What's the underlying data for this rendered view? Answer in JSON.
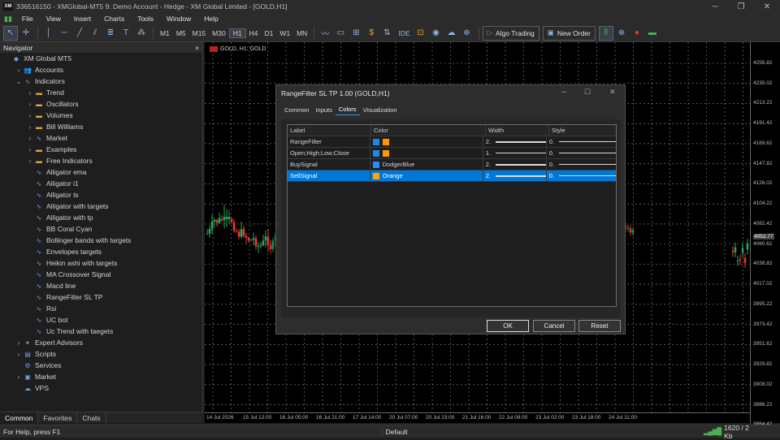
{
  "window": {
    "title": "336516150 - XMGlobal-MT5 9: Demo Account - Hedge - XM Global Limited - [GOLD,H1]",
    "logo": "XM"
  },
  "menu": [
    "File",
    "View",
    "Insert",
    "Charts",
    "Tools",
    "Window",
    "Help"
  ],
  "toolbar": {
    "timeframes": [
      "M1",
      "M5",
      "M15",
      "M30",
      "H1",
      "H4",
      "D1",
      "W1",
      "MN"
    ],
    "active_tf": "H1",
    "ide": "IDE",
    "algo": "Algo Trading",
    "new_order": "New Order"
  },
  "navigator": {
    "title": "Navigator",
    "close": "×",
    "items": [
      {
        "level": 0,
        "arrow": "",
        "icon": "xm-icon",
        "label": "XM Global MT5"
      },
      {
        "level": 1,
        "arrow": "›",
        "icon": "accounts-icon",
        "label": "Accounts"
      },
      {
        "level": 1,
        "arrow": "⌄",
        "icon": "indicators-icon",
        "label": "Indicators"
      },
      {
        "level": 2,
        "arrow": "›",
        "icon": "folder-icon",
        "label": "Trend"
      },
      {
        "level": 2,
        "arrow": "›",
        "icon": "folder-icon",
        "label": "Oscillators"
      },
      {
        "level": 2,
        "arrow": "›",
        "icon": "folder-icon",
        "label": "Volumes"
      },
      {
        "level": 2,
        "arrow": "›",
        "icon": "folder-icon",
        "label": "Bill Williams"
      },
      {
        "level": 2,
        "arrow": "›",
        "icon": "indicator-icon",
        "label": "Market"
      },
      {
        "level": 2,
        "arrow": "›",
        "icon": "folder-icon",
        "label": "Examples"
      },
      {
        "level": 2,
        "arrow": "›",
        "icon": "folder-icon",
        "label": "Free Indicators"
      },
      {
        "level": 2,
        "arrow": "",
        "icon": "indicator-icon",
        "label": "Alligator ema"
      },
      {
        "level": 2,
        "arrow": "",
        "icon": "indicator-icon",
        "label": "Alligator i1"
      },
      {
        "level": 2,
        "arrow": "",
        "icon": "indicator-icon",
        "label": "Alligator ts"
      },
      {
        "level": 2,
        "arrow": "",
        "icon": "indicator-icon",
        "label": "Alligator with targets"
      },
      {
        "level": 2,
        "arrow": "",
        "icon": "indicator-icon",
        "label": "Alligator with tp"
      },
      {
        "level": 2,
        "arrow": "",
        "icon": "indicator-icon",
        "label": "BB Coral Cyan"
      },
      {
        "level": 2,
        "arrow": "",
        "icon": "indicator-icon",
        "label": "Bollinger bands with targets"
      },
      {
        "level": 2,
        "arrow": "",
        "icon": "indicator-icon",
        "label": "Envelopes targets"
      },
      {
        "level": 2,
        "arrow": "",
        "icon": "indicator-icon",
        "label": "Heikin ashi with targets"
      },
      {
        "level": 2,
        "arrow": "",
        "icon": "indicator-icon",
        "label": "MA Crossover Signal"
      },
      {
        "level": 2,
        "arrow": "",
        "icon": "indicator-icon",
        "label": "Macd line"
      },
      {
        "level": 2,
        "arrow": "",
        "icon": "indicator-icon",
        "label": "RangeFilter SL TP"
      },
      {
        "level": 2,
        "arrow": "",
        "icon": "indicator-icon",
        "label": "Rsi"
      },
      {
        "level": 2,
        "arrow": "",
        "icon": "indicator-icon",
        "label": "UC bot"
      },
      {
        "level": 2,
        "arrow": "",
        "icon": "indicator-icon",
        "label": "Uc Trend with taegets"
      },
      {
        "level": 1,
        "arrow": "›",
        "icon": "experts-icon",
        "label": "Expert Advisors"
      },
      {
        "level": 1,
        "arrow": "›",
        "icon": "scripts-icon",
        "label": "Scripts"
      },
      {
        "level": 1,
        "arrow": "",
        "icon": "services-icon",
        "label": "Services"
      },
      {
        "level": 1,
        "arrow": "›",
        "icon": "market-icon",
        "label": "Market"
      },
      {
        "level": 1,
        "arrow": "",
        "icon": "vps-icon",
        "label": "VPS"
      }
    ],
    "tabs": [
      "Common",
      "Favorites",
      "Chats"
    ]
  },
  "chart": {
    "symbol": "GOLD, H1: GOLD",
    "colors": {
      "bull": "#26a65b",
      "bear": "#e53935",
      "grid": "#8a8a8a"
    },
    "y_labels": [
      "4256.82",
      "4235.02",
      "4213.22",
      "4191.42",
      "4169.62",
      "4147.82",
      "4126.02",
      "4104.22",
      "4082.42",
      "4060.62",
      "4038.82",
      "4017.02",
      "3995.22",
      "3973.42",
      "3951.62",
      "3929.82",
      "3908.02",
      "3886.22",
      "3864.42"
    ],
    "current_price": "4052.77",
    "x_labels": [
      "14 Jul 2026",
      "15 Jul 12:00",
      "16 Jul 05:00",
      "16 Jul 21:00",
      "17 Jul 14:00",
      "20 Jul 07:00",
      "20 Jul 23:00",
      "21 Jul 16:00",
      "22 Jul 09:00",
      "23 Jul 02:00",
      "23 Jul 18:00",
      "24 Jul 11:00"
    ]
  },
  "dialog": {
    "title": "RangeFilter SL TP 1.00 (GOLD,H1)",
    "tabs": [
      "Common",
      "Inputs",
      "Colors",
      "Visualization"
    ],
    "active_tab": "Colors",
    "columns": [
      "Label",
      "Color",
      "Width",
      "Style"
    ],
    "rows": [
      {
        "label": "RangeFilter",
        "colors": [
          "#1e88e5",
          "#ff9800"
        ],
        "color_name": "",
        "width": "2.",
        "style": "0."
      },
      {
        "label": "Open;High;Low;Close",
        "colors": [
          "#1e88e5",
          "#ff9800"
        ],
        "color_name": "",
        "width": "1.",
        "style": "0."
      },
      {
        "label": "BuySignal",
        "colors": [
          "#1e90ff"
        ],
        "color_name": "DodgerBlue",
        "width": "2.",
        "style": "0."
      },
      {
        "label": "SellSignal",
        "colors": [
          "#ffa500"
        ],
        "color_name": "Orange",
        "width": "2.",
        "style": "0."
      }
    ],
    "selected_row": 3,
    "buttons": {
      "ok": "OK",
      "cancel": "Cancel",
      "reset": "Reset"
    }
  },
  "status": {
    "help": "For Help, press F1",
    "profile": "Default",
    "traffic": "1620 / 2 Kb"
  }
}
